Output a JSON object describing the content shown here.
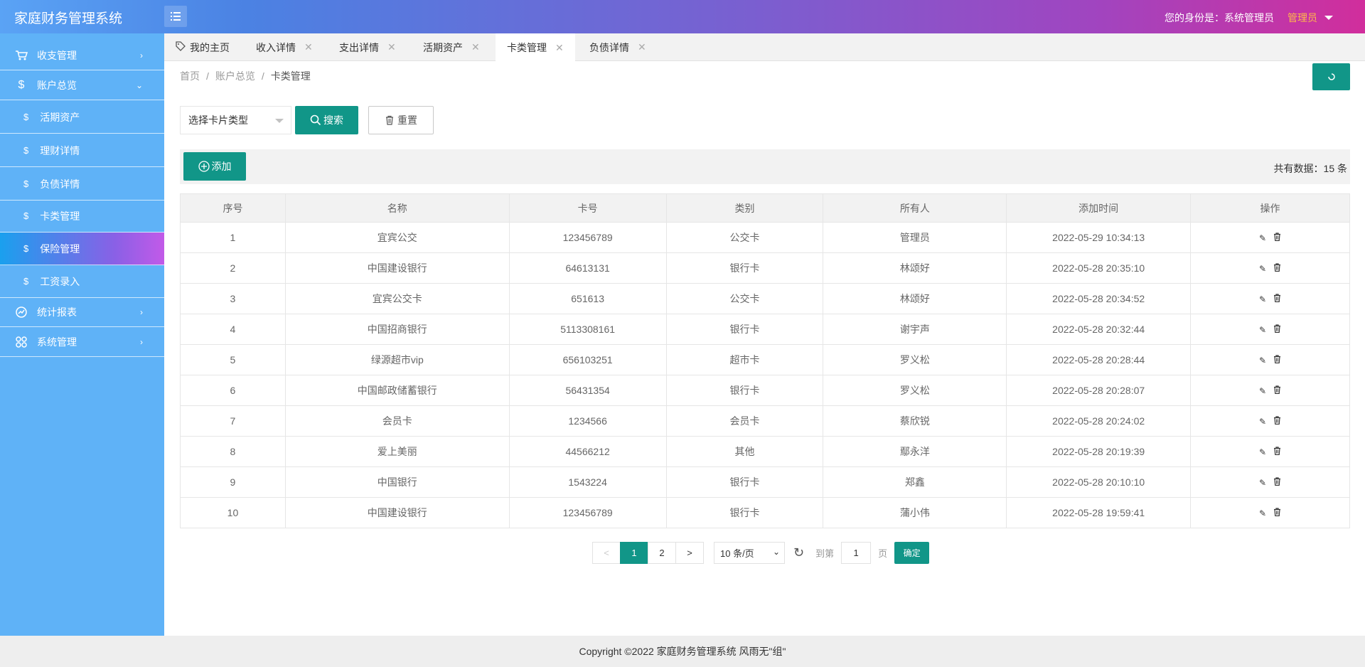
{
  "header": {
    "app_title": "家庭财务管理系统",
    "identity": "您的身份是：系统管理员",
    "user_menu": "管理员"
  },
  "sidebar": {
    "items": [
      {
        "label": "收支管理",
        "icon": "cart-icon"
      },
      {
        "label": "账户总览",
        "icon": "dollar-icon"
      },
      {
        "label": "统计报表",
        "icon": "chart-icon"
      },
      {
        "label": "系统管理",
        "icon": "grid-icon"
      }
    ],
    "sub_items": [
      {
        "label": "活期资产"
      },
      {
        "label": "理财详情"
      },
      {
        "label": "负债详情"
      },
      {
        "label": "卡类管理"
      },
      {
        "label": "保险管理"
      },
      {
        "label": "工资录入"
      }
    ],
    "active_sub": "保险管理"
  },
  "tabs": [
    {
      "label": "我的主页"
    },
    {
      "label": "收入详情"
    },
    {
      "label": "支出详情"
    },
    {
      "label": "活期资产"
    },
    {
      "label": "卡类管理"
    },
    {
      "label": "负债详情"
    }
  ],
  "breadcrumb": [
    "首页",
    "账户总览",
    "卡类管理"
  ],
  "search": {
    "select_value": "选择卡片类型",
    "search_label": "搜索",
    "reset_label": "重置"
  },
  "toolbar": {
    "add_label": "添加",
    "total_text": "共有数据：15 条"
  },
  "table": {
    "columns": [
      "序号",
      "名称",
      "卡号",
      "类别",
      "所有人",
      "添加时间",
      "操作"
    ],
    "rows": [
      [
        "1",
        "宜宾公交",
        "123456789",
        "公交卡",
        "管理员",
        "2022-05-29 10:34:13"
      ],
      [
        "2",
        "中国建设银行",
        "64613131",
        "银行卡",
        "林颂好",
        "2022-05-28 20:35:10"
      ],
      [
        "3",
        "宜宾公交卡",
        "651613",
        "公交卡",
        "林颂好",
        "2022-05-28 20:34:52"
      ],
      [
        "4",
        "中国招商银行",
        "5113308161",
        "银行卡",
        "谢宇声",
        "2022-05-28 20:32:44"
      ],
      [
        "5",
        "绿源超市vip",
        "656103251",
        "超市卡",
        "罗义松",
        "2022-05-28 20:28:44"
      ],
      [
        "6",
        "中国邮政储蓄银行",
        "56431354",
        "银行卡",
        "罗义松",
        "2022-05-28 20:28:07"
      ],
      [
        "7",
        "会员卡",
        "1234566",
        "会员卡",
        "蔡欣锐",
        "2022-05-28 20:24:02"
      ],
      [
        "8",
        "爱上美丽",
        "44566212",
        "其他",
        "鄢永洋",
        "2022-05-28 20:19:39"
      ],
      [
        "9",
        "中国银行",
        "1543224",
        "银行卡",
        "郑鑫",
        "2022-05-28 20:10:10"
      ],
      [
        "10",
        "中国建设银行",
        "123456789",
        "银行卡",
        "蒲小伟",
        "2022-05-28 19:59:41"
      ]
    ]
  },
  "pagination": {
    "prev": "<",
    "pages": [
      "1",
      "2"
    ],
    "current": "1",
    "next": ">",
    "per_page": "10 条/页",
    "goto_label": "到第",
    "goto_value": "1",
    "page_label": "页",
    "confirm_label": "确定"
  },
  "footer": {
    "text": "Copyright ©2022 家庭财务管理系统 风雨无\"组\""
  },
  "colors": {
    "primary": "#119688",
    "sidebar": "#5fb2f7",
    "admin_accent": "#ffb84a"
  }
}
